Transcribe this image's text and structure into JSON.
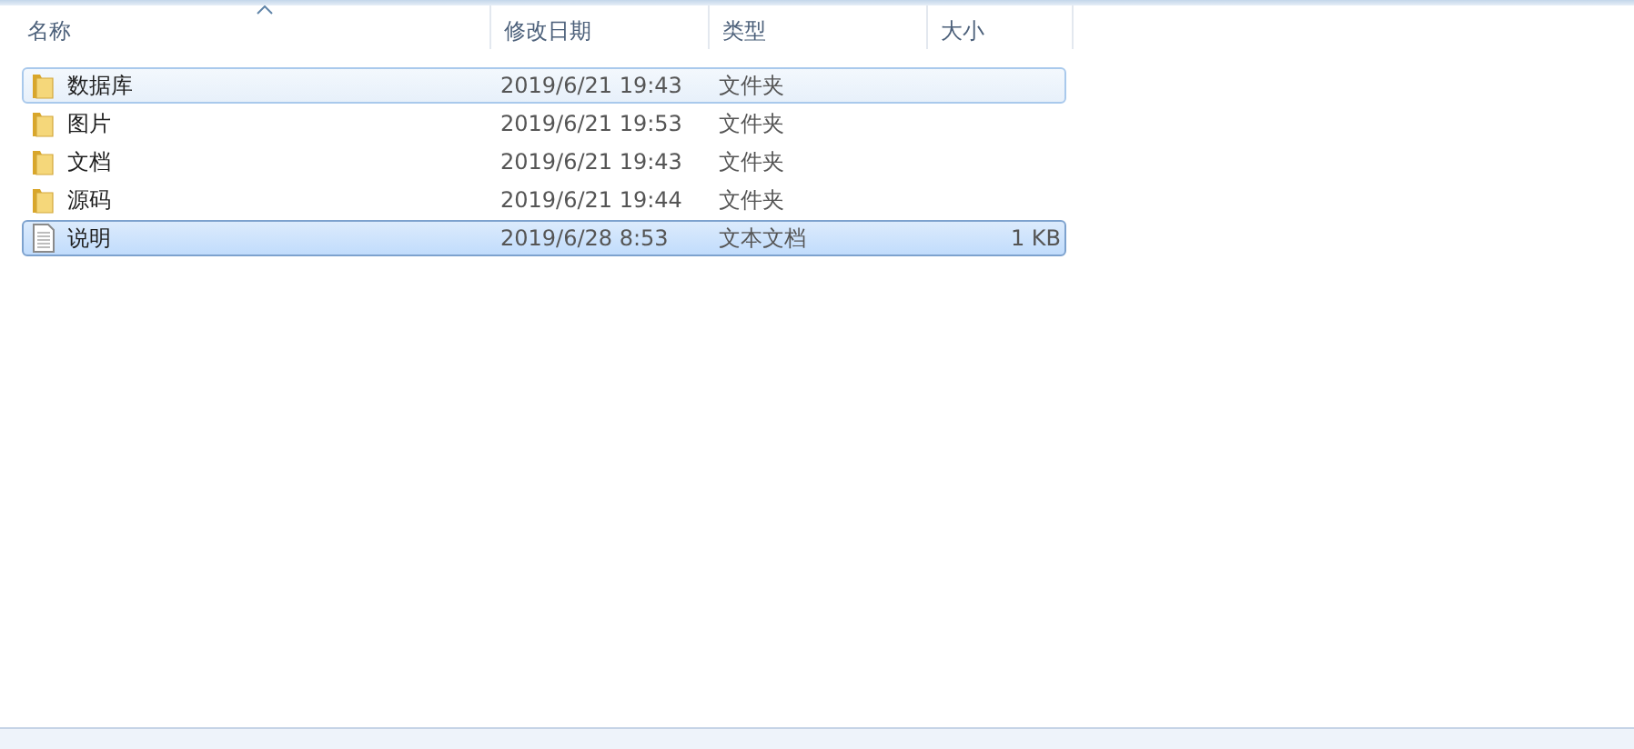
{
  "columns": [
    {
      "label": "名称",
      "sorted": true
    },
    {
      "label": "修改日期",
      "sorted": false
    },
    {
      "label": "类型",
      "sorted": false
    },
    {
      "label": "大小",
      "sorted": false
    }
  ],
  "rows": [
    {
      "kind": "folder",
      "name": "数据库",
      "modified": "2019/6/21 19:43",
      "type": "文件夹",
      "selected": true,
      "hovered": false
    },
    {
      "kind": "folder",
      "name": "图片",
      "modified": "2019/6/21 19:53",
      "type": "文件夹",
      "selected": false,
      "hovered": false
    },
    {
      "kind": "folder",
      "name": "文档",
      "modified": "2019/6/21 19:43",
      "type": "文件夹",
      "selected": false,
      "hovered": false
    },
    {
      "kind": "folder",
      "name": "源码",
      "modified": "2019/6/21 19:44",
      "type": "文件夹",
      "selected": false,
      "hovered": false
    },
    {
      "kind": "text",
      "name": "说明",
      "modified": "2019/6/28 8:53",
      "type": "文本文档",
      "size": "1 KB",
      "selected": true,
      "hovered": true
    }
  ]
}
